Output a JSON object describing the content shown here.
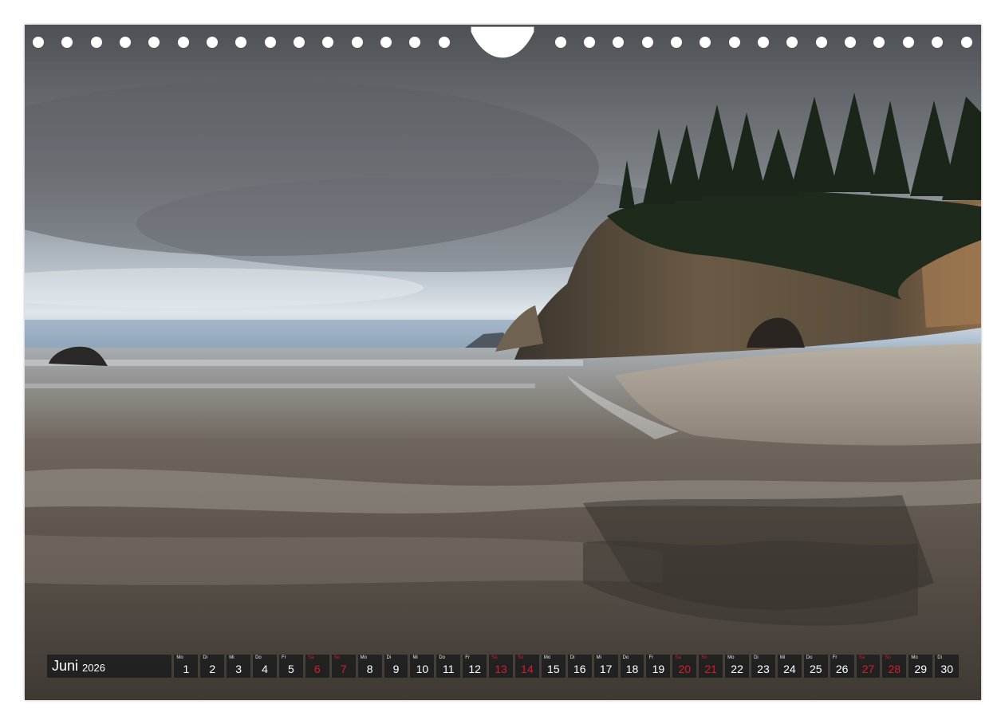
{
  "calendar": {
    "month": "Juni",
    "year": "2026",
    "days": [
      {
        "wd": "Mo",
        "n": "1",
        "red": false
      },
      {
        "wd": "Di",
        "n": "2",
        "red": false
      },
      {
        "wd": "Mi",
        "n": "3",
        "red": false
      },
      {
        "wd": "Do",
        "n": "4",
        "red": false
      },
      {
        "wd": "Fr",
        "n": "5",
        "red": false
      },
      {
        "wd": "Sa",
        "n": "6",
        "red": true
      },
      {
        "wd": "So",
        "n": "7",
        "red": true
      },
      {
        "wd": "Mo",
        "n": "8",
        "red": false
      },
      {
        "wd": "Di",
        "n": "9",
        "red": false
      },
      {
        "wd": "Mi",
        "n": "10",
        "red": false
      },
      {
        "wd": "Do",
        "n": "11",
        "red": false
      },
      {
        "wd": "Fr",
        "n": "12",
        "red": false
      },
      {
        "wd": "Sa",
        "n": "13",
        "red": true
      },
      {
        "wd": "So",
        "n": "14",
        "red": true
      },
      {
        "wd": "Mo",
        "n": "15",
        "red": false
      },
      {
        "wd": "Di",
        "n": "16",
        "red": false
      },
      {
        "wd": "Mi",
        "n": "17",
        "red": false
      },
      {
        "wd": "Do",
        "n": "18",
        "red": false
      },
      {
        "wd": "Fr",
        "n": "19",
        "red": false
      },
      {
        "wd": "Sa",
        "n": "20",
        "red": true
      },
      {
        "wd": "So",
        "n": "21",
        "red": true
      },
      {
        "wd": "Mo",
        "n": "22",
        "red": false
      },
      {
        "wd": "Di",
        "n": "23",
        "red": false
      },
      {
        "wd": "Mi",
        "n": "24",
        "red": false
      },
      {
        "wd": "Do",
        "n": "25",
        "red": false
      },
      {
        "wd": "Fr",
        "n": "26",
        "red": false
      },
      {
        "wd": "Sa",
        "n": "27",
        "red": true
      },
      {
        "wd": "So",
        "n": "28",
        "red": true
      },
      {
        "wd": "Mo",
        "n": "29",
        "red": false
      },
      {
        "wd": "Di",
        "n": "30",
        "red": false
      }
    ]
  },
  "colors": {
    "weekend": "#d11f2a",
    "bar_background": "#1e1e1e",
    "text": "#ffffff"
  }
}
